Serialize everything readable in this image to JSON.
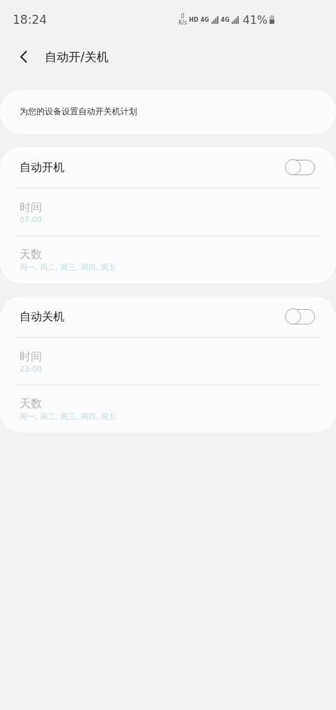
{
  "status_bar": {
    "time": "18:24",
    "net_speed_value": "0",
    "net_speed_unit": "K/s",
    "hd": "HD",
    "network_1": "4G",
    "network_2": "4G",
    "battery": "41%"
  },
  "header": {
    "title": "自动开/关机"
  },
  "description": "为您的设备设置自动开关机计划",
  "schedules": [
    {
      "title": "自动开机",
      "on": false,
      "rows": [
        {
          "label": "时间",
          "value": "07:00"
        },
        {
          "label": "天数",
          "value": "周一, 周二, 周三, 周四, 周五"
        }
      ]
    },
    {
      "title": "自动关机",
      "on": false,
      "rows": [
        {
          "label": "时间",
          "value": "23:00"
        },
        {
          "label": "天数",
          "value": "周一, 周二, 周三, 周四, 周五"
        }
      ]
    }
  ]
}
